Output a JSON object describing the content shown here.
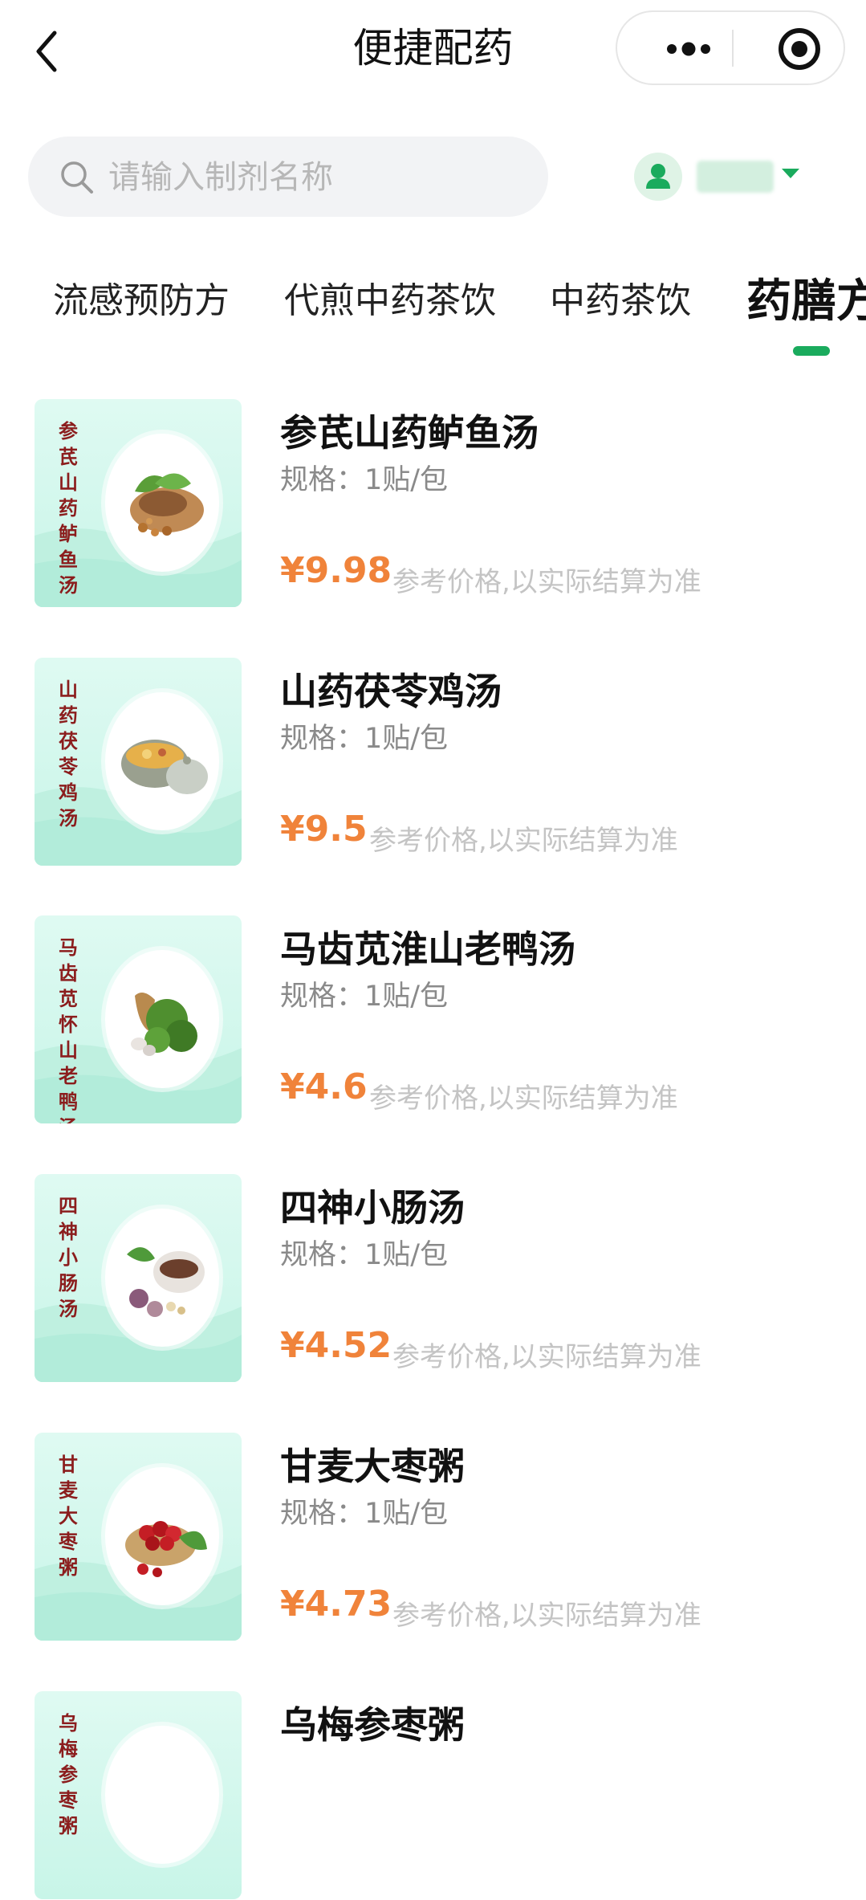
{
  "header": {
    "title": "便捷配药"
  },
  "search": {
    "placeholder": "请输入制剂名称"
  },
  "tabs": [
    {
      "label": "流感预防方"
    },
    {
      "label": "代煎中药茶饮"
    },
    {
      "label": "中药茶饮"
    },
    {
      "label": "药膳方",
      "active": true
    }
  ],
  "products": [
    {
      "name": "参芪山药鲈鱼汤",
      "thumb_label": "参芪山药鲈鱼汤",
      "spec": "规格：1贴/包",
      "price": "¥9.98",
      "note": "参考价格,以实际结算为准"
    },
    {
      "name": "山药茯苓鸡汤",
      "thumb_label": "山药茯苓鸡汤",
      "spec": "规格：1贴/包",
      "price": "¥9.5",
      "note": "参考价格,以实际结算为准"
    },
    {
      "name": "马齿苋淮山老鸭汤",
      "thumb_label": "马齿苋怀山老鸭汤",
      "spec": "规格：1贴/包",
      "price": "¥4.6",
      "note": "参考价格,以实际结算为准"
    },
    {
      "name": "四神小肠汤",
      "thumb_label": "四神小肠汤",
      "spec": "规格：1贴/包",
      "price": "¥4.52",
      "note": "参考价格,以实际结算为准"
    },
    {
      "name": "甘麦大枣粥",
      "thumb_label": "甘麦大枣粥",
      "spec": "规格：1贴/包",
      "price": "¥4.73",
      "note": "参考价格,以实际结算为准"
    },
    {
      "name": "乌梅参枣粥",
      "thumb_label": "乌梅参枣粥",
      "spec": "规格：1贴/包",
      "price": "",
      "note": ""
    }
  ],
  "colors": {
    "accent": "#1aab5d",
    "price": "#f0833a",
    "thumb_bg": "#c8f5e8",
    "thumb_text": "#8b1d1d"
  },
  "icons": {
    "back": "chevron-left-icon",
    "more": "more-dots-icon",
    "target": "target-icon",
    "search": "search-icon",
    "user": "user-icon",
    "caret": "caret-down-icon"
  }
}
